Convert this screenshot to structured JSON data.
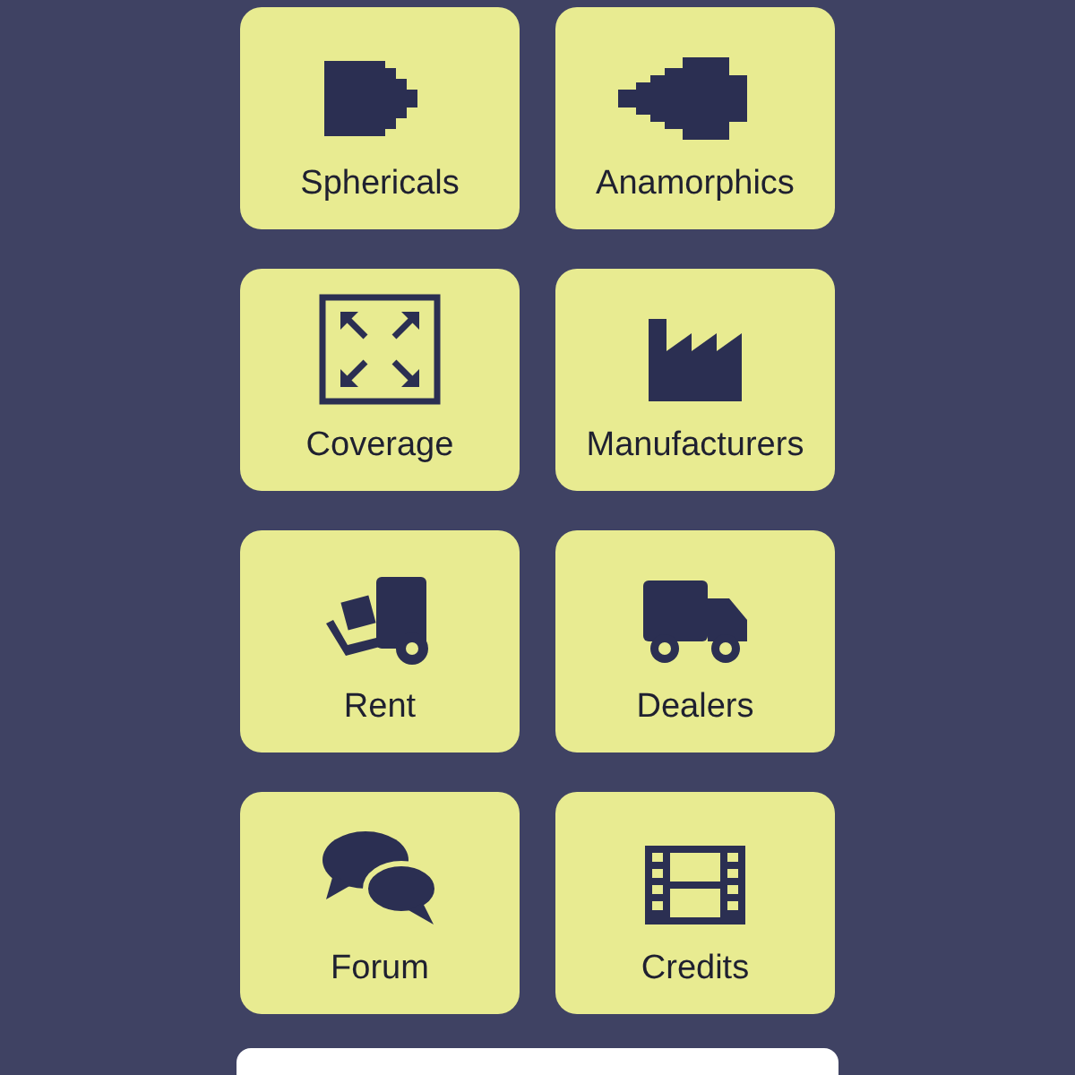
{
  "tiles": [
    {
      "label": "Sphericals",
      "kind": "spherical"
    },
    {
      "label": "Anamorphics",
      "kind": "anamorphic"
    },
    {
      "label": "Coverage",
      "kind": "coverage"
    },
    {
      "label": "Manufacturers",
      "kind": "factory"
    },
    {
      "label": "Rent",
      "kind": "dolly"
    },
    {
      "label": "Dealers",
      "kind": "truck"
    },
    {
      "label": "Forum",
      "kind": "chat"
    },
    {
      "label": "Credits",
      "kind": "film"
    }
  ]
}
